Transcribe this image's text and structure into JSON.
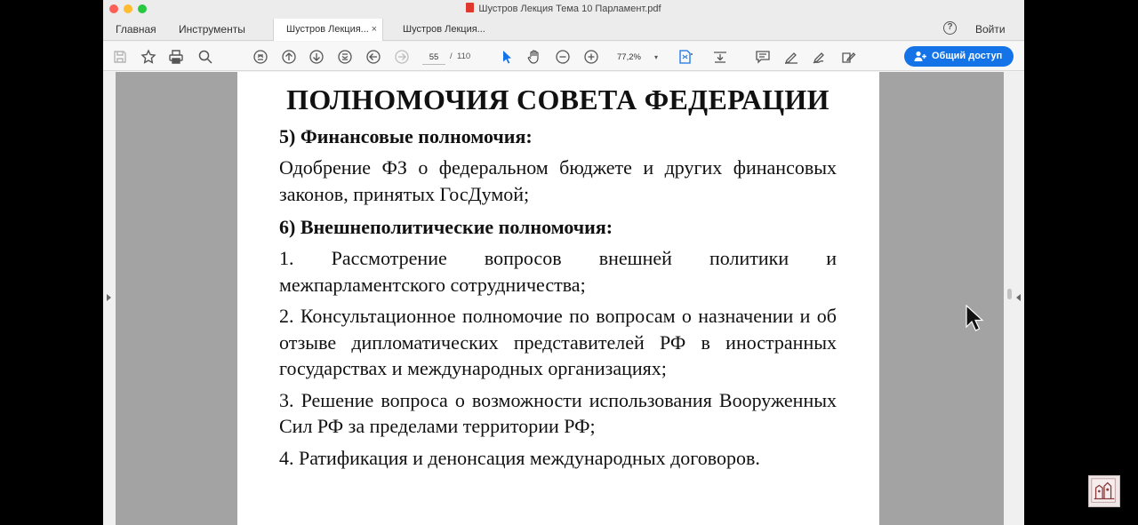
{
  "window": {
    "title": "Шустров Лекция Тема 10 Парламент.pdf"
  },
  "tabbar": {
    "nav": [
      "Главная",
      "Инструменты"
    ],
    "doc_tabs": [
      {
        "label": "Шустров Лекция...",
        "active": true
      },
      {
        "label": "Шустров Лекция...",
        "active": false
      }
    ],
    "close_glyph": "×",
    "help_glyph": "?",
    "signin_label": "Войти"
  },
  "toolbar": {
    "icons": [
      "save-icon",
      "star-icon",
      "print-icon",
      "search-icon",
      "scroll-up-page-icon",
      "prev-page-icon",
      "next-page-icon",
      "scroll-down-page-icon",
      "back-icon",
      "forward-icon",
      "pointer-icon",
      "hand-icon",
      "zoom-out-icon",
      "zoom-in-icon",
      "fit-page-icon",
      "stamp-icon",
      "comment-icon",
      "highlight-icon",
      "sign-icon",
      "edit-icon"
    ],
    "page_current": "55",
    "page_separator": "/",
    "page_total": "110",
    "zoom": "77,2%",
    "zoom_caret": "▾",
    "share_label": "Общий доступ",
    "accent": "#1473e6"
  },
  "document": {
    "title": "ПОЛНОМОЧИЯ СОВЕТА ФЕДЕРАЦИИ",
    "heading5": "5) Финансовые полномочия:",
    "para5": "Одобрение ФЗ о федеральном бюджете и других финансовых законов, принятых ГосДумой;",
    "heading6": "6) Внешнеполитические полномочия:",
    "items": [
      "1. Рассмотрение вопросов внешней политики и межпарламентского сотрудничества;",
      "2. Консультационное полномочие по вопросам о назначении и об отзыве дипломатических представителей РФ в иностранных государствах и международных организациях;",
      "3. Решение вопроса о возможности использования Вооруженных Сил РФ за пределами территории РФ;",
      "4. Ратификация и денонсация международных договоров."
    ]
  }
}
